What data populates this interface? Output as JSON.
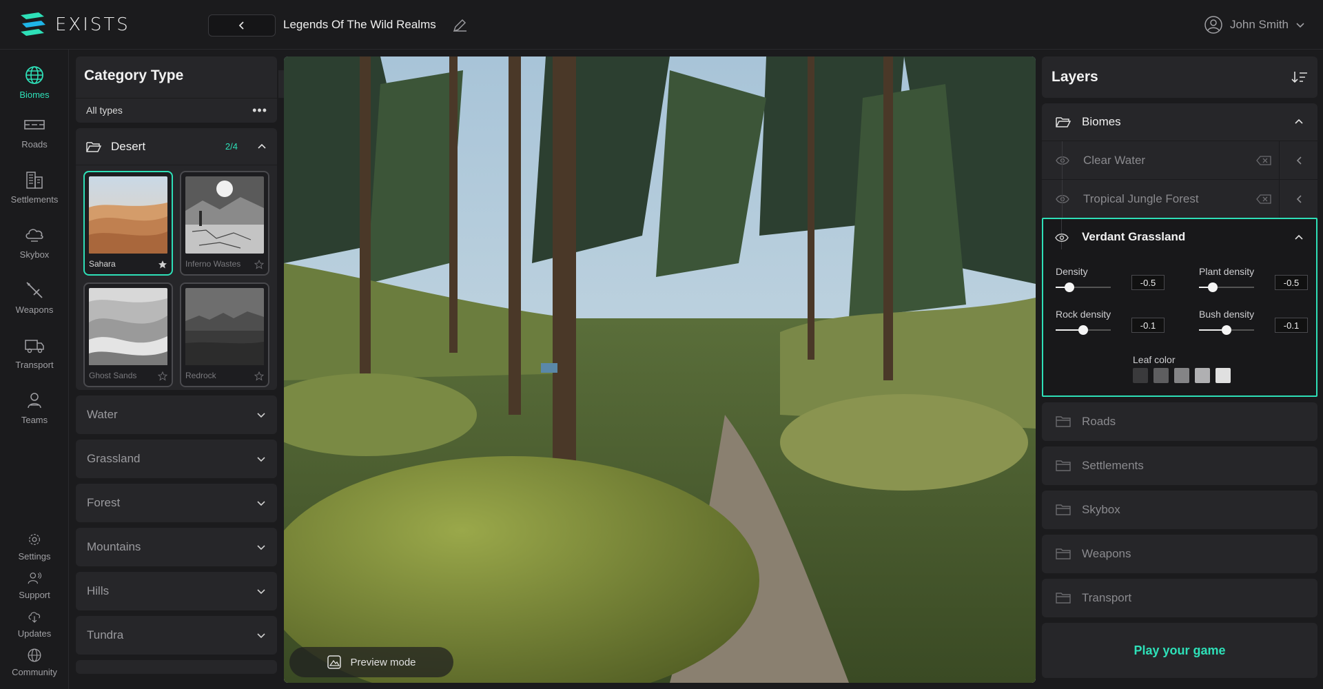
{
  "app": {
    "logo_text": "EXISTS",
    "project_title": "Legends Of The Wild Realms",
    "accent": "#2ee0b8"
  },
  "user": {
    "name": "John Smith"
  },
  "rail": {
    "items": [
      {
        "label": "Biomes",
        "icon": "globe-icon"
      },
      {
        "label": "Roads",
        "icon": "road-icon"
      },
      {
        "label": "Settlements",
        "icon": "buildings-icon"
      },
      {
        "label": "Skybox",
        "icon": "cloud-icon"
      },
      {
        "label": "Weapons",
        "icon": "weapon-icon"
      },
      {
        "label": "Transport",
        "icon": "truck-icon"
      },
      {
        "label": "Teams",
        "icon": "team-icon"
      }
    ],
    "bottom": [
      {
        "label": "Settings",
        "icon": "gear-icon"
      },
      {
        "label": "Support",
        "icon": "support-icon"
      },
      {
        "label": "Updates",
        "icon": "cloud-download-icon"
      },
      {
        "label": "Community",
        "icon": "globe-icon"
      }
    ]
  },
  "category": {
    "title": "Category Type",
    "filter": "All types",
    "open_group": {
      "name": "Desert",
      "count": "2/4"
    },
    "tiles": [
      {
        "label": "Sahara",
        "selected": true,
        "favorite": true
      },
      {
        "label": "Inferno Wastes",
        "selected": false,
        "favorite": false
      },
      {
        "label": "Ghost Sands",
        "selected": false,
        "favorite": false
      },
      {
        "label": "Redrock",
        "selected": false,
        "favorite": false
      }
    ],
    "groups": [
      "Water",
      "Grassland",
      "Forest",
      "Mountains",
      "Hills",
      "Tundra"
    ]
  },
  "viewport": {
    "preview_label": "Preview mode"
  },
  "layers": {
    "title": "Layers",
    "biomes_label": "Biomes",
    "rows": [
      "Clear Water",
      "Tropical Jungle Forest"
    ],
    "active": {
      "name": "Verdant Grassland",
      "params": [
        {
          "label": "Density",
          "value": "-0.5",
          "level": 0.25
        },
        {
          "label": "Plant density",
          "value": "-0.5",
          "level": 0.25
        },
        {
          "label": "Rock density",
          "value": "-0.1",
          "level": 0.5
        },
        {
          "label": "Bush density",
          "value": "-0.1",
          "level": 0.5
        }
      ],
      "leaf_label": "Leaf color",
      "leaf_colors": [
        "#3a3a3c",
        "#5e5e60",
        "#848486",
        "#b0b0b2",
        "#e0e0e0"
      ]
    },
    "sections": [
      "Roads",
      "Settlements",
      "Skybox",
      "Weapons",
      "Transport"
    ],
    "play_label": "Play your game"
  }
}
